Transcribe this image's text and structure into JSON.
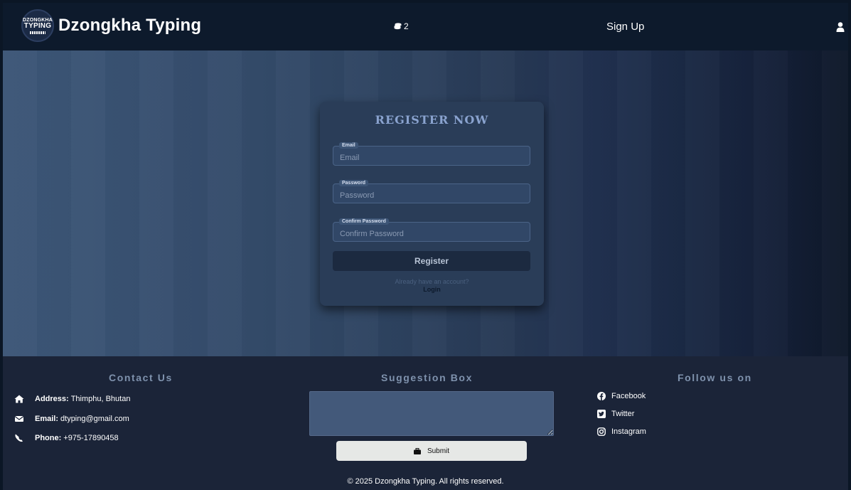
{
  "navbar": {
    "logo_line1": "DZONGKHA",
    "logo_line2": "TYPING",
    "brand": "Dzongkha Typing",
    "coins": "2",
    "signup": "Sign Up",
    "icons": {
      "coins": "coins-icon",
      "user": "user-icon"
    }
  },
  "form": {
    "title": "Register Now",
    "email_label": "Email",
    "email_placeholder": "Email",
    "password_label": "Password",
    "password_placeholder": "Password",
    "confirm_label": "Confirm Password",
    "confirm_placeholder": "Confirm Password",
    "register_button": "Register",
    "already": "Already have an account?",
    "login": "Login"
  },
  "footer": {
    "contact_title": "Contact Us",
    "address_label": "Address:",
    "address_value": "Thimphu, Bhutan",
    "email_label": "Email:",
    "email_value": "dtyping@gmail.com",
    "phone_label": "Phone:",
    "phone_value": "+975-17890458",
    "suggestion_title": "Suggestion Box",
    "submit": "Submit",
    "follow_title": "Follow us on",
    "facebook": "Facebook",
    "twitter": "Twitter",
    "instagram": "Instagram",
    "copyright": "© 2025 Dzongkha Typing. All rights reserved.",
    "icons": [
      "home-icon",
      "envelope-icon",
      "phone-icon",
      "facebook-icon",
      "twitter-icon",
      "instagram-icon",
      "briefcase-icon"
    ]
  },
  "colors": {
    "navbar_bg": "#0d1a2c",
    "card_bg": "#2a3d58",
    "title_accent": "#8aa3cf",
    "footer_bg": "#1b2438",
    "button_dark": "#1c2a40",
    "submit_bg": "#e6e8e6"
  }
}
